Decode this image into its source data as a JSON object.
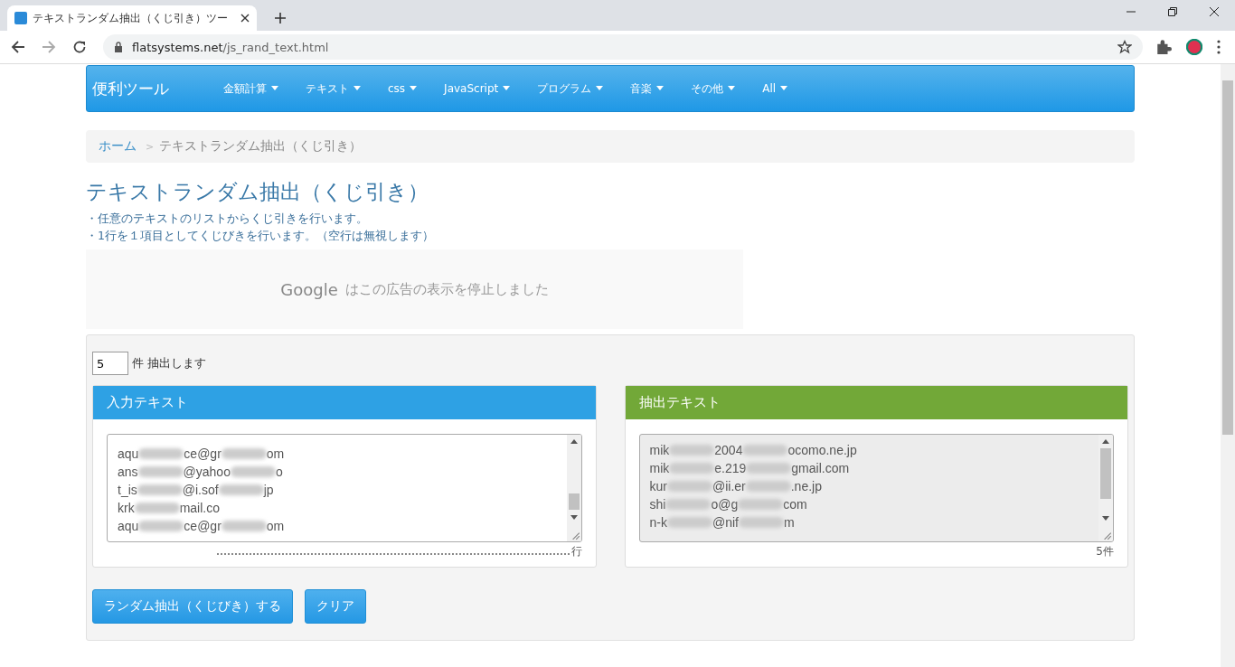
{
  "browser": {
    "tab_title": "テキストランダム抽出（くじ引き）ツー",
    "url_host": "flatsystems.net",
    "url_path": "/js_rand_text.html"
  },
  "nav": {
    "brand": "便利ツール",
    "items": [
      "金額計算",
      "テキスト",
      "css",
      "JavaScript",
      "プログラム",
      "音楽",
      "その他",
      "All"
    ]
  },
  "breadcrumb": {
    "home": "ホーム",
    "separator": ">",
    "current": "テキストランダム抽出（くじ引き）"
  },
  "title": "テキストランダム抽出（くじ引き）",
  "notes": [
    "・任意のテキストのリストからくじ引きを行います。",
    "・1行を１項目としてくじびきを行います。（空行は無視します）"
  ],
  "ad": {
    "brand": "Google",
    "message": "はこの広告の表示を停止しました"
  },
  "count": {
    "value": "5",
    "label": "件 抽出します"
  },
  "input_panel": {
    "title": "入力テキスト",
    "lines": [
      {
        "parts": [
          "aqu",
          "ce@gr",
          "om"
        ]
      },
      {
        "parts": [
          "ans",
          "@yahoo",
          "o"
        ]
      },
      {
        "parts": [
          "t_is",
          "@i.sof",
          "jp"
        ]
      },
      {
        "parts": [
          "krk",
          "mail.co"
        ]
      },
      {
        "parts": [
          "aqu",
          "ce@gr",
          "om"
        ]
      }
    ],
    "footer": "行"
  },
  "output_panel": {
    "title": "抽出テキスト",
    "lines": [
      {
        "parts": [
          "mik",
          "2004",
          "ocomo.ne.jp"
        ]
      },
      {
        "parts": [
          "mik",
          "e.219",
          "gmail.com"
        ]
      },
      {
        "parts": [
          "kur",
          "@ii.er",
          ".ne.jp"
        ]
      },
      {
        "parts": [
          "shi",
          "o@g",
          "com"
        ]
      },
      {
        "parts": [
          "n-k",
          "@nif",
          "m"
        ]
      }
    ],
    "footer": "5件"
  },
  "buttons": [
    "ランダム抽出（くじびき）する",
    "クリア"
  ]
}
